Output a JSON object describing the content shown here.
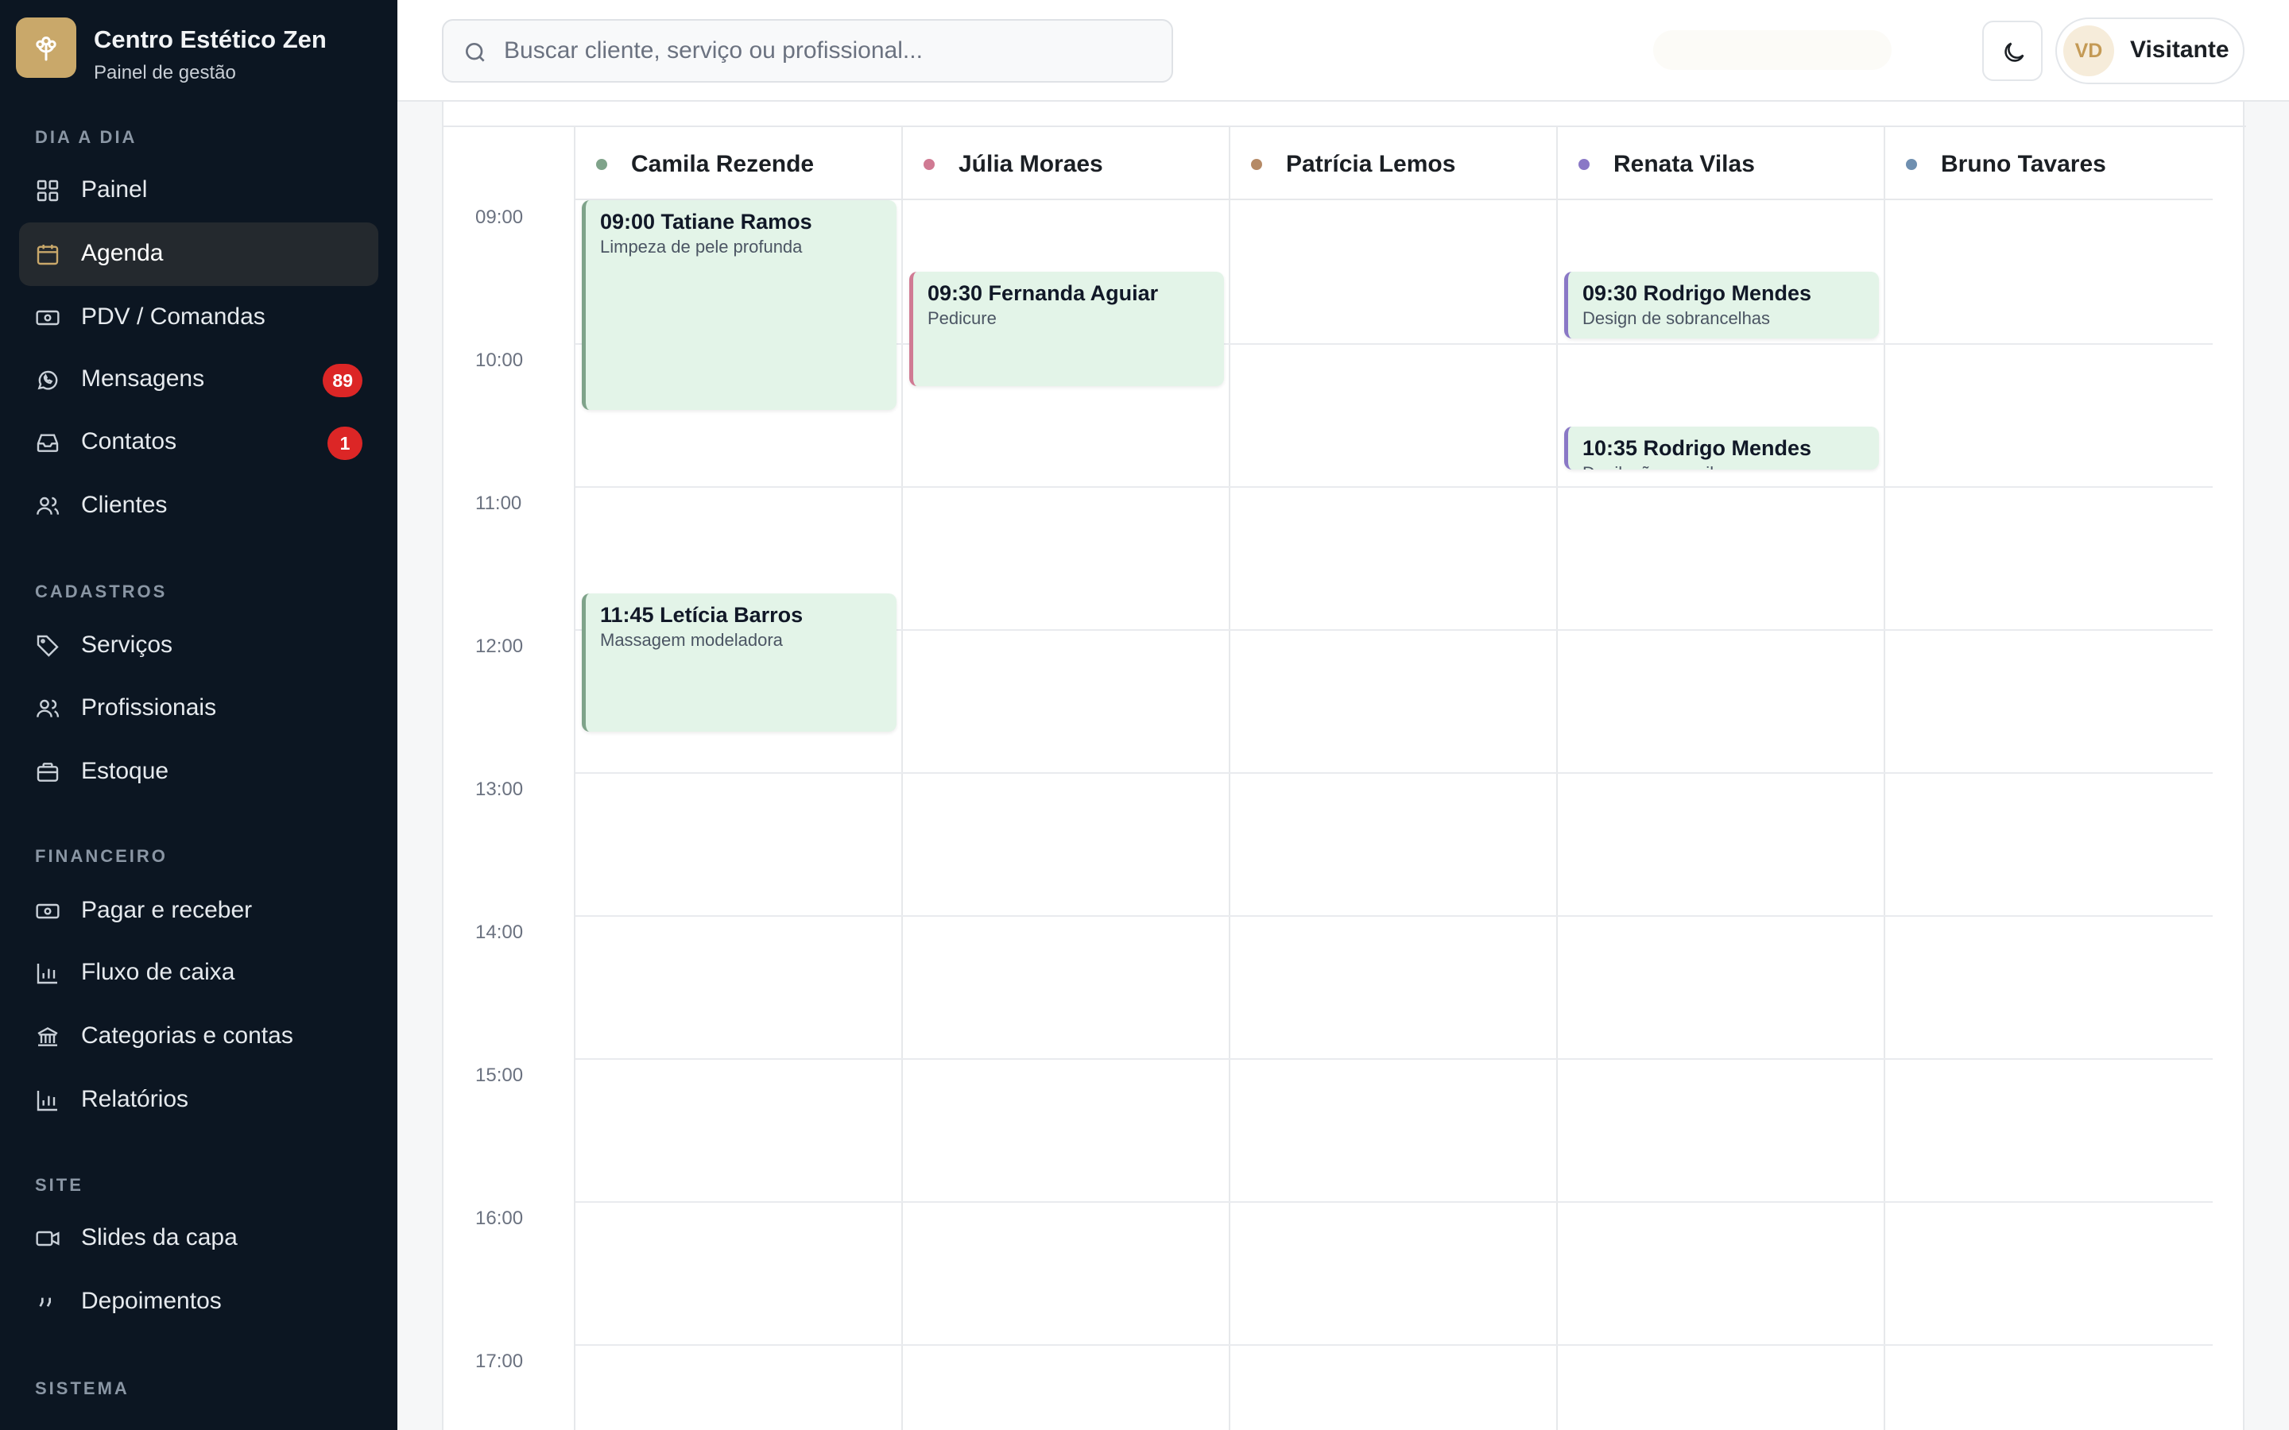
{
  "brand": {
    "title": "Centro Estético Zen",
    "subtitle": "Painel de gestão",
    "accent": "#c9a86a"
  },
  "sidebar": {
    "sections": [
      {
        "label": "Dia a dia",
        "items": [
          {
            "label": "Painel",
            "icon": "grid-icon"
          },
          {
            "label": "Agenda",
            "icon": "calendar-icon",
            "active": true
          },
          {
            "label": "PDV / Comandas",
            "icon": "cash-icon"
          },
          {
            "label": "Mensagens",
            "icon": "whatsapp-icon",
            "badge": "89"
          },
          {
            "label": "Contatos",
            "icon": "inbox-icon",
            "badge": "1"
          },
          {
            "label": "Clientes",
            "icon": "users-icon"
          }
        ]
      },
      {
        "label": "Cadastros",
        "items": [
          {
            "label": "Serviços",
            "icon": "tag-icon"
          },
          {
            "label": "Profissionais",
            "icon": "users-icon"
          },
          {
            "label": "Estoque",
            "icon": "briefcase-icon"
          }
        ]
      },
      {
        "label": "Financeiro",
        "items": [
          {
            "label": "Pagar e receber",
            "icon": "cash-icon"
          },
          {
            "label": "Fluxo de caixa",
            "icon": "bar-chart-icon"
          },
          {
            "label": "Categorias e contas",
            "icon": "bank-icon"
          },
          {
            "label": "Relatórios",
            "icon": "bar-chart-icon"
          }
        ]
      },
      {
        "label": "Site",
        "items": [
          {
            "label": "Slides da capa",
            "icon": "video-icon"
          },
          {
            "label": "Depoimentos",
            "icon": "quote-icon"
          }
        ]
      },
      {
        "label": "Sistema",
        "items": []
      }
    ]
  },
  "search": {
    "placeholder": "Buscar cliente, serviço ou profissional..."
  },
  "user": {
    "initials": "VD",
    "name": "Visitante"
  },
  "calendar": {
    "times": [
      "09:00",
      "10:00",
      "11:00",
      "12:00",
      "13:00",
      "14:00",
      "15:00",
      "16:00",
      "17:00"
    ],
    "professionals": [
      {
        "name": "Camila Rezende",
        "color": "#7fa38a"
      },
      {
        "name": "Júlia Moraes",
        "color": "#d07a93"
      },
      {
        "name": "Patrícia Lemos",
        "color": "#b58a66"
      },
      {
        "name": "Renata Vilas",
        "color": "#8a78c6"
      },
      {
        "name": "Bruno Tavares",
        "color": "#6f8fb0"
      }
    ],
    "appointments": [
      {
        "col": 0,
        "start": "09:00",
        "duration_min": 90,
        "title": "09:00 Tatiane Ramos",
        "service": "Limpeza de pele profunda"
      },
      {
        "col": 0,
        "start": "11:45",
        "duration_min": 60,
        "title": "11:45 Letícia Barros",
        "service": "Massagem modeladora"
      },
      {
        "col": 1,
        "start": "09:30",
        "duration_min": 50,
        "title": "09:30 Fernanda Aguiar",
        "service": "Pedicure"
      },
      {
        "col": 3,
        "start": "09:30",
        "duration_min": 30,
        "title": "09:30 Rodrigo Mendes",
        "service": "Design de sobrancelhas"
      },
      {
        "col": 3,
        "start": "10:35",
        "duration_min": 20,
        "title": "10:35 Rodrigo Mendes",
        "service": "Depilação — axilas"
      }
    ]
  }
}
